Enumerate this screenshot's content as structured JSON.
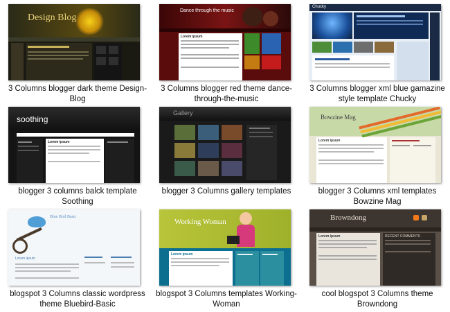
{
  "items": [
    {
      "caption": "3 Columns blogger dark theme Design-Blog",
      "banner_title": "Design Blog"
    },
    {
      "caption": "3 Columns blogger red theme dance-through-the-music",
      "banner_title": "Dance through the music",
      "post_title": "Lorem ipsum"
    },
    {
      "caption": "3 Columns blogger xml blue gamazine style template Chucky",
      "banner_title": "Chucky"
    },
    {
      "caption": "blogger 3 columns balck template Soothing",
      "banner_title": "soothing",
      "post_title": "Lorem ipsum"
    },
    {
      "caption": "blogger 3 Columns gallery templates",
      "banner_title": "Gallery"
    },
    {
      "caption": "blogger 3 Columns xml templates Bowzine Mag",
      "banner_title": "Bowzine Mag",
      "post_title": "Lorem ipsum"
    },
    {
      "caption": "blogspot 3 Columns classic wordpress theme Bluebird-Basic",
      "banner_title": "Blue Bird Basic",
      "post_title": "Lorem ipsum"
    },
    {
      "caption": "blogspot 3 Columns templates Working-Woman",
      "banner_title": "Working Woman",
      "post_title": "Lorem ipsum"
    },
    {
      "caption": "cool blogspot 3 Columns theme Browndong",
      "banner_title": "Browndong",
      "post_title": "Lorem ipsum",
      "sidebar_heading": "RECENT COMMENTS"
    }
  ]
}
